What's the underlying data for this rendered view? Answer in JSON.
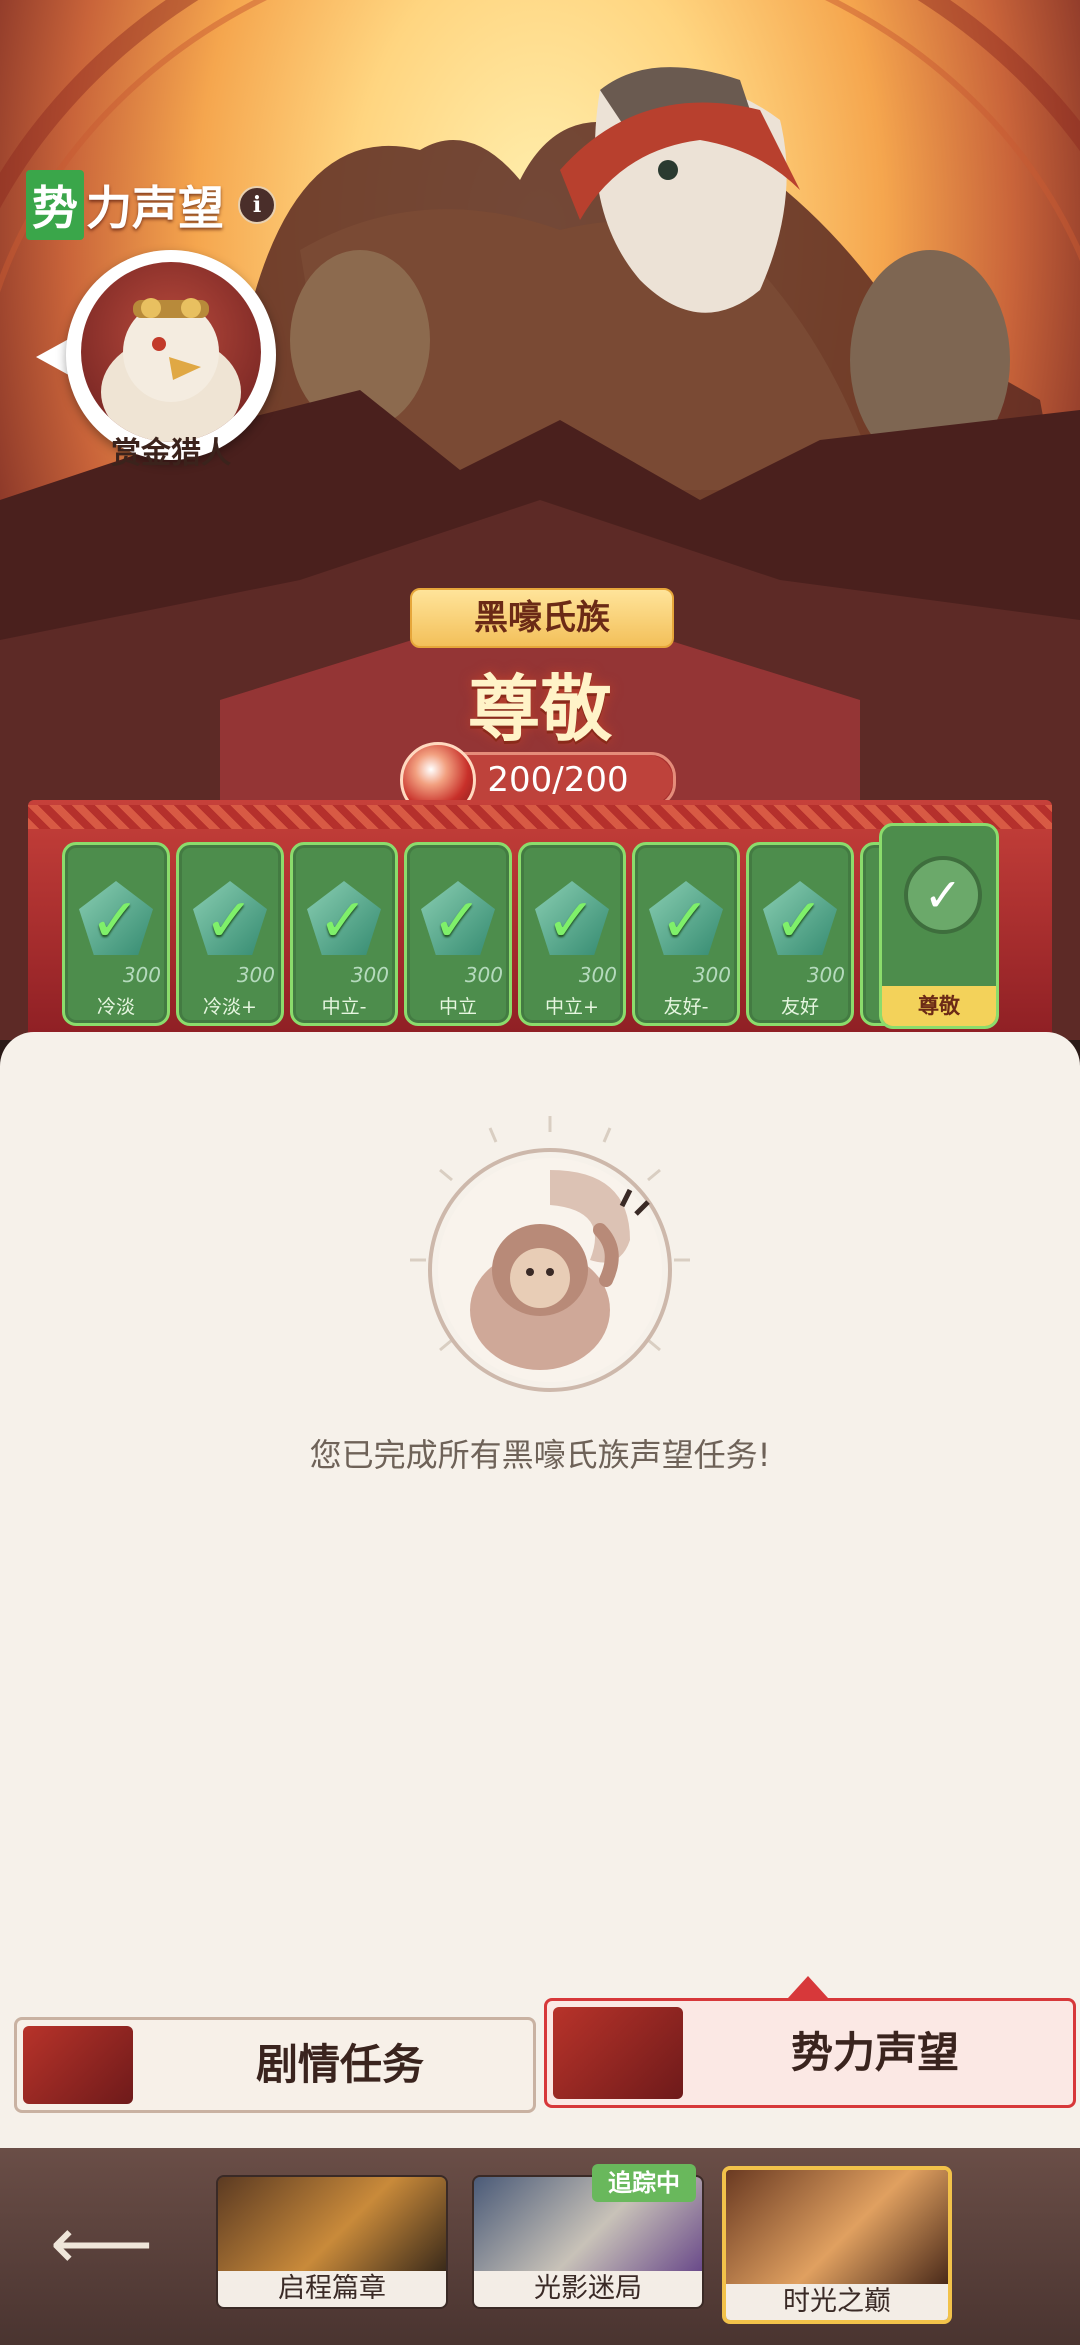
{
  "header": {
    "title_first_char": "势",
    "title_rest": "力声望",
    "info_icon": "i"
  },
  "npc": {
    "name": "赏金猎人"
  },
  "faction": {
    "name": "黑嚎氏族",
    "rank": "尊敬",
    "progress_text": "200/200",
    "progress": 1.0
  },
  "stages": [
    {
      "label": "冷淡",
      "points": "300",
      "completed": true
    },
    {
      "label": "冷淡+",
      "points": "300",
      "completed": true
    },
    {
      "label": "中立-",
      "points": "300",
      "completed": true
    },
    {
      "label": "中立",
      "points": "300",
      "completed": true
    },
    {
      "label": "中立+",
      "points": "300",
      "completed": true
    },
    {
      "label": "友好-",
      "points": "300",
      "completed": true
    },
    {
      "label": "友好",
      "points": "300",
      "completed": true
    }
  ],
  "final_stage": {
    "label": "尊敬",
    "completed": true
  },
  "panel": {
    "completion_message": "您已完成所有黑嚎氏族声望任务!"
  },
  "tabs": {
    "story": "剧情任务",
    "reputation": "势力声望",
    "active": "reputation"
  },
  "chapters": [
    {
      "label": "启程篇章",
      "active": false,
      "tracking": false
    },
    {
      "label": "光影迷局",
      "active": false,
      "tracking": true
    },
    {
      "label": "时光之巅",
      "active": true,
      "tracking": false
    }
  ],
  "tracking_tag": "追踪中",
  "colors": {
    "accent_red": "#d7383a",
    "stage_green": "#4d8d4c",
    "check_green": "#7ff06a",
    "panel_bg": "#f6f1ea"
  }
}
